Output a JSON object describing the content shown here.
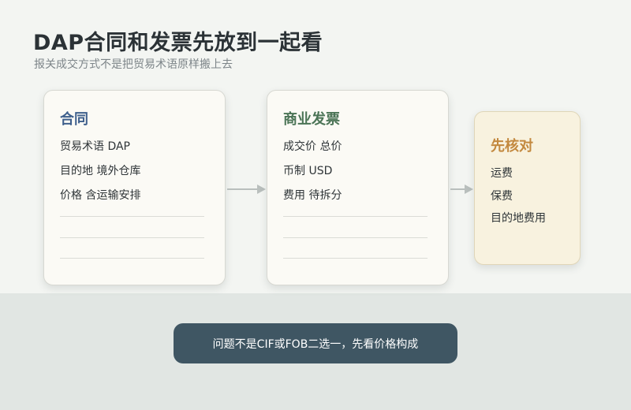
{
  "header": {
    "title": "DAP合同和发票先放到一起看",
    "subtitle": "报关成交方式不是把贸易术语原样搬上去"
  },
  "contract": {
    "title": "合同",
    "lines": [
      "贸易术语 DAP",
      "目的地 境外仓库",
      "价格 含运输安排"
    ]
  },
  "invoice": {
    "title": "商业发票",
    "lines": [
      "成交价 总价",
      "币制 USD",
      "费用 待拆分"
    ]
  },
  "check": {
    "title": "先核对",
    "lines": [
      "运费",
      "保费",
      "目的地费用"
    ]
  },
  "note": {
    "text": "问题不是CIF或FOB二选一，先看价格构成"
  },
  "colors": {
    "contract_title": "#3e5f8c",
    "invoice_title": "#4b7456",
    "check_title": "#c3893f",
    "check_bg": "#f8f2df",
    "note_bg": "#3f5663",
    "arrow": "#b9bfbd"
  }
}
